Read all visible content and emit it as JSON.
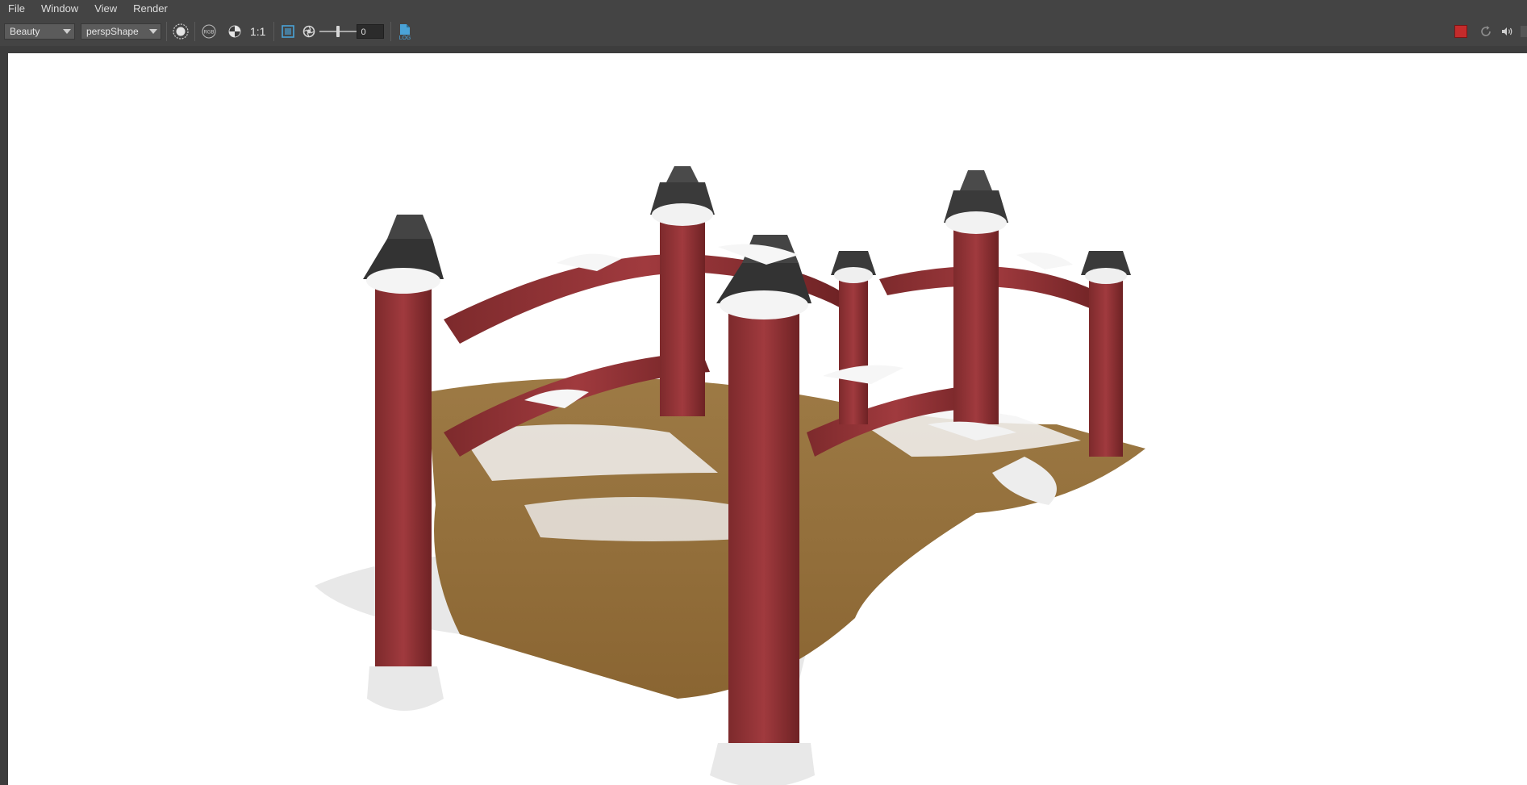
{
  "menubar": {
    "items": [
      "File",
      "Window",
      "View",
      "Render"
    ]
  },
  "toolbar": {
    "aov_select": "Beauty",
    "camera_select": "perspShape",
    "ratio_label": "1:1",
    "exposure_value": "0",
    "log_label": "LOG"
  },
  "icons": {
    "display_channel": "circle-dotted-icon",
    "rgb": "rgb-icon",
    "snapshot": "snapshot-icon",
    "region": "crop-region-icon",
    "exposure": "aperture-icon",
    "log": "log-file-icon",
    "stop": "stop-render-icon",
    "refresh": "refresh-icon",
    "audio": "speaker-icon"
  },
  "colors": {
    "ui_background": "#444444",
    "viewport_background": "#ffffff",
    "stop_button": "#c42b2b",
    "accent_blue": "#4aa3d8"
  }
}
